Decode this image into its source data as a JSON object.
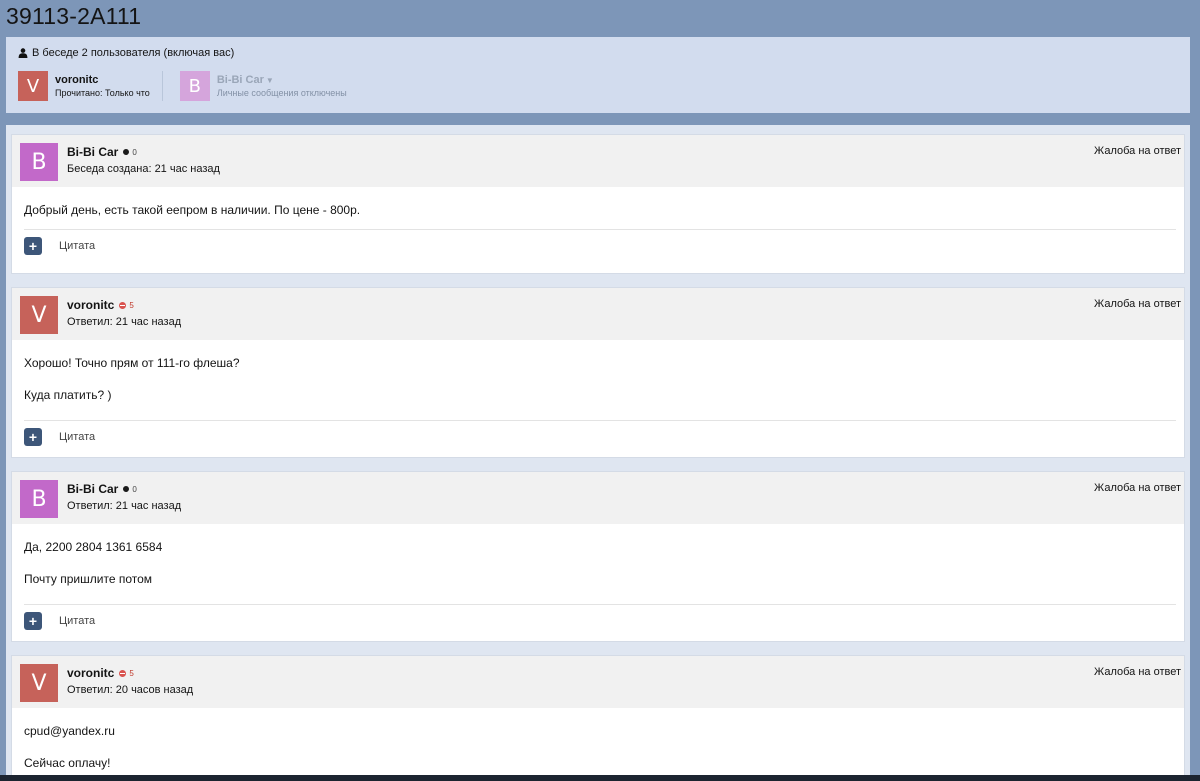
{
  "page": {
    "title": "39113-2A111"
  },
  "participants": {
    "header": "В беседе 2 пользователя (включая вас)",
    "list": [
      {
        "initial": "V",
        "name": "voronitc",
        "status": "Прочитано: Только что"
      },
      {
        "initial": "B",
        "name": "Bi-Bi Car",
        "status": "Личные сообщения отключены"
      }
    ]
  },
  "report_label": "Жалоба на ответ",
  "quote_label": "Цитата",
  "messages": [
    {
      "initial": "B",
      "author": "Bi-Bi Car",
      "reputation": "0",
      "posted": "Беседа создана: 21 час назад",
      "lines": [
        "Добрый день, есть такой еепром в наличии. По цене - 800р."
      ]
    },
    {
      "initial": "V",
      "author": "voronitc",
      "reputation": "5",
      "posted": "Ответил: 21 час назад",
      "lines": [
        "Хорошо! Точно прям от 111-го флеша?",
        "Куда платить? )"
      ]
    },
    {
      "initial": "B",
      "author": "Bi-Bi Car",
      "reputation": "0",
      "posted": "Ответил: 21 час назад",
      "lines": [
        "Да, 2200 2804 1361 6584",
        "Почту пришлите потом"
      ]
    },
    {
      "initial": "V",
      "author": "voronitc",
      "reputation": "5",
      "posted": "Ответил: 20 часов назад",
      "lines": [
        "cpud@yandex.ru",
        "Сейчас оплачу!"
      ]
    }
  ],
  "colors": {
    "avatar_v": "#c6625a",
    "avatar_b": "#c269c9",
    "quote_button": "#3d5679",
    "background": "#7d96b8"
  },
  "icons": {
    "participants": "user-icon",
    "quote": "plus-icon",
    "caret": "caret-down-icon"
  }
}
